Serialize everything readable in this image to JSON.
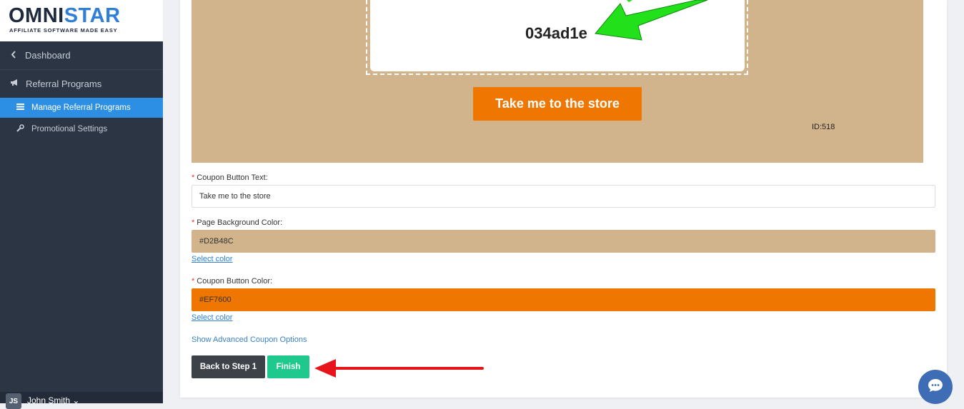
{
  "brand": {
    "name_prefix": "OMNI",
    "name_suffix": "STAR",
    "tagline": "AFFILIATE SOFTWARE MADE EASY"
  },
  "sidebar": {
    "items": [
      {
        "label": "Dashboard",
        "icon": "chevron-left-icon"
      },
      {
        "label": "Referral Programs",
        "icon": "megaphone-icon"
      },
      {
        "label": "Manage Referral Programs",
        "icon": "list-icon",
        "active": true
      },
      {
        "label": "Promotional Settings",
        "icon": "wrench-icon"
      }
    ],
    "user": {
      "initials": "JS",
      "name": "John Smith ⌄"
    }
  },
  "preview": {
    "coupon_code": "034ad1e",
    "store_button_label": "Take me to the store",
    "id_label": "ID:518",
    "background_color": "#D2B48C",
    "button_color": "#EF7600"
  },
  "form": {
    "coupon_button_text": {
      "label": "Coupon Button Text:",
      "value": "Take me to the store"
    },
    "page_background_color": {
      "label": "Page Background Color:",
      "value": "#D2B48C",
      "link": "Select color"
    },
    "coupon_button_color": {
      "label": "Coupon Button Color:",
      "value": "#EF7600",
      "link": "Select color"
    },
    "advanced_link": "Show Advanced Coupon Options",
    "required_marker": "*"
  },
  "actions": {
    "back_label": "Back to Step 1",
    "finish_label": "Finish"
  },
  "colors": {
    "accent": "#2d8fe3",
    "finish": "#1fc98e",
    "arrow_green": "#22e01a",
    "arrow_red": "#e8141b"
  }
}
